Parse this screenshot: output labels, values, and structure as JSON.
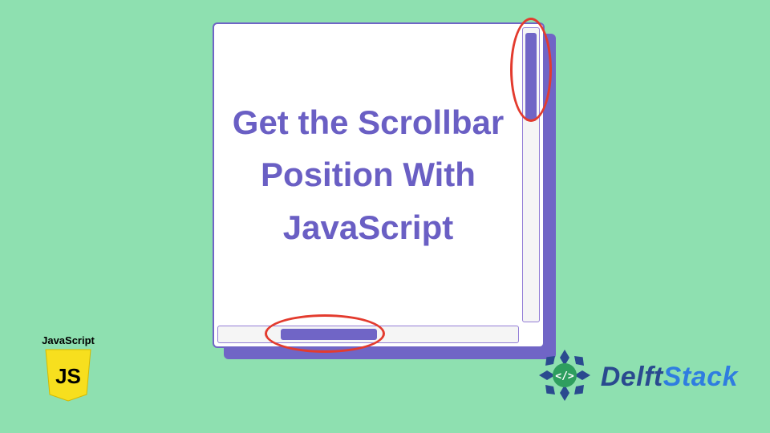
{
  "title": "Get the Scrollbar Position With JavaScript",
  "badge": {
    "label": "JavaScript",
    "symbol": "JS"
  },
  "brand": {
    "part1": "Delft",
    "part2": "Stack"
  },
  "colors": {
    "bg": "#8ee0b0",
    "accent": "#7065c6",
    "highlight": "#e33b2e",
    "js": "#f7df1e"
  }
}
